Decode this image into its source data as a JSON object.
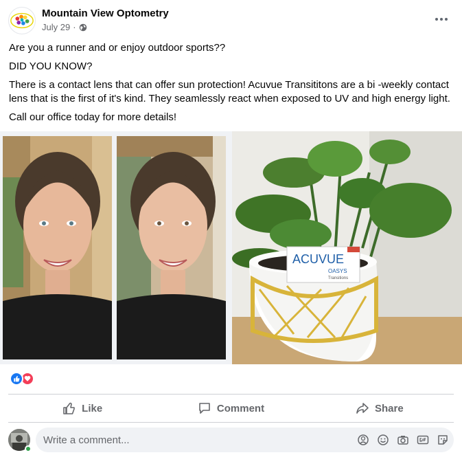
{
  "post": {
    "page_name": "Mountain View Optometry",
    "date": "July 29",
    "separator": "·",
    "visibility_icon": "globe-icon",
    "paragraphs": [
      "Are you a runner and or enjoy outdoor sports??",
      "DID YOU KNOW?",
      "There is a contact lens that can offer sun protection! Acuvue Transititons are a bi -weekly contact lens that is the first of it's kind. They seamlessly react when exposed to UV and high energy light.",
      "Call our office today for more details!"
    ],
    "photo_alts": [
      "Woman smiling, before photo",
      "Woman smiling, after photo",
      "Acuvue Oasys Transitions box in a potted plant"
    ],
    "product_box": {
      "brand": "ACUVUE",
      "line": "OASYS",
      "variant": "Transitions"
    }
  },
  "reactions": {
    "icons": [
      "like-icon",
      "love-icon"
    ]
  },
  "actions": {
    "like_label": "Like",
    "comment_label": "Comment",
    "share_label": "Share"
  },
  "comment": {
    "placeholder": "Write a comment...",
    "icons": [
      "avatar-sticker-icon",
      "emoji-icon",
      "camera-icon",
      "gif-icon",
      "sticker-icon"
    ]
  },
  "colors": {
    "accent": "#1877f2",
    "love": "#f33e58",
    "secondary_text": "#65676b",
    "divider": "#ced0d4",
    "input_bg": "#f0f2f5"
  }
}
